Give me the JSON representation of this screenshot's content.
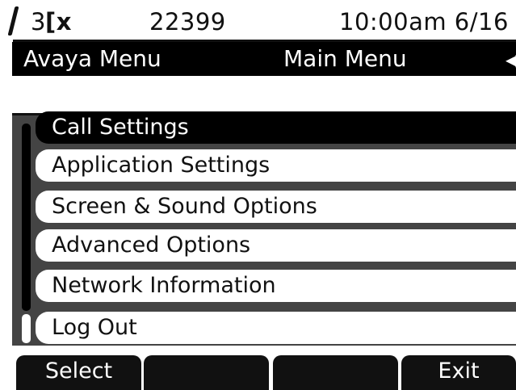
{
  "status": {
    "line_label": "3",
    "missed_icon": "x",
    "extension": "22399",
    "time_date": "10:00am 6/16"
  },
  "title_bar": {
    "left": "Avaya Menu",
    "center": "Main Menu",
    "nav_icon": "left-right-arrows"
  },
  "menu": {
    "items": [
      {
        "label": "Call Settings",
        "selected": true
      },
      {
        "label": "Application Settings",
        "selected": false
      },
      {
        "label": "Screen & Sound Options",
        "selected": false
      },
      {
        "label": "Advanced Options",
        "selected": false
      },
      {
        "label": "Network Information",
        "selected": false
      },
      {
        "label": "Log Out",
        "selected": false
      }
    ]
  },
  "softkeys": [
    "Select",
    "",
    "",
    "Exit"
  ],
  "colors": {
    "background": "#ffffff",
    "bar": "#000000",
    "highlight": "#000000"
  }
}
